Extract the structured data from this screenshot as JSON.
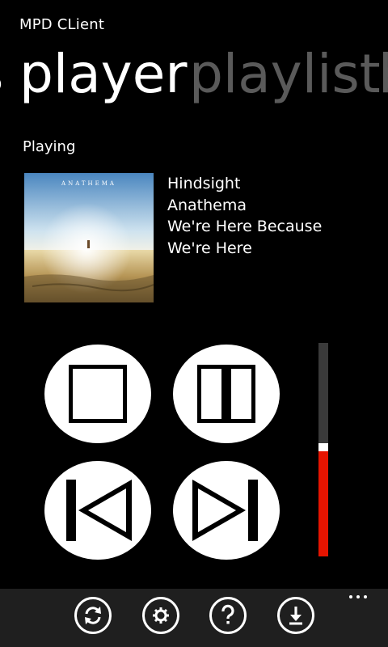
{
  "app": {
    "title": "MPD CLient"
  },
  "pivot": {
    "previous_fragment": "s",
    "active": "player",
    "next": "playlist",
    "next_fragment": "b"
  },
  "now_playing": {
    "section_label": "Playing",
    "title": "Hindsight",
    "artist": "Anathema",
    "album_line1": "We're Here Because",
    "album_line2": "We're Here",
    "cover_text": "ANATHEMA"
  },
  "controls": [
    "stop-icon",
    "pause-icon",
    "previous-icon",
    "next-icon"
  ],
  "volume": {
    "level_percent": 50,
    "fill_color": "#e51400"
  },
  "app_bar": {
    "buttons": [
      "refresh-icon",
      "settings-icon",
      "help-icon",
      "download-icon"
    ],
    "more": "ellipsis-icon"
  },
  "colors": {
    "accent": "#e51400",
    "inactive_pivot": "#5a5a5a",
    "app_bar": "#1f1f1f"
  }
}
